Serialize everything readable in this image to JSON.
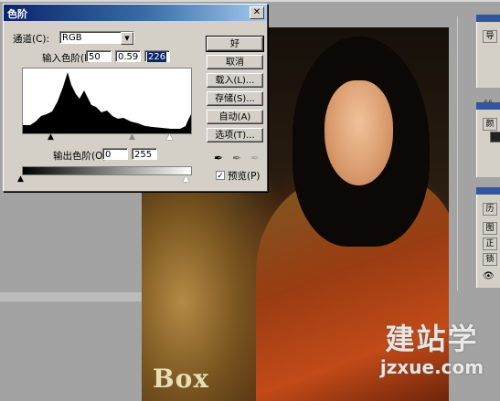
{
  "dialog": {
    "title": "色阶",
    "close_glyph": "✕",
    "channel_label": "通道(C):",
    "channel_value": "RGB",
    "input_levels_label": "输入色阶(I):",
    "input_black": "50",
    "input_gamma": "0.59",
    "input_white": "226",
    "output_levels_label": "输出色阶(O):",
    "output_black": "0",
    "output_white": "255",
    "buttons": {
      "ok": "好",
      "cancel": "取消",
      "load": "载入(L)...",
      "save": "存储(S)...",
      "auto": "自动(A)",
      "options": "选项(T)..."
    },
    "eyedroppers": [
      "black-eyedropper-icon",
      "gray-eyedropper-icon",
      "white-eyedropper-icon"
    ],
    "preview_label": "预览(P)",
    "preview_checked": true
  },
  "right_panels": {
    "tab1": "导",
    "value": "66",
    "tab2": "颜",
    "tab3": "历",
    "tab4": "图",
    "tab5": "正",
    "tab6": "锁"
  },
  "photo": {
    "text": "Box"
  },
  "watermark": {
    "line1": "建站学",
    "line2": "jzxue.com"
  },
  "colors": {
    "titlebar_start": "#0a246a",
    "titlebar_end": "#a6caf0",
    "dialog_bg": "#d4d0c8",
    "workspace": "#a3a3a3"
  }
}
